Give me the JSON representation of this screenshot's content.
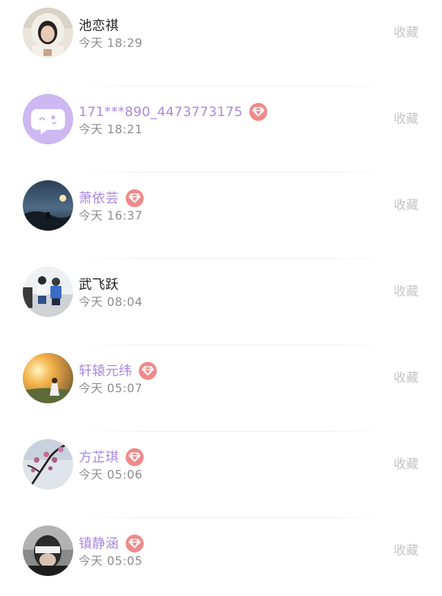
{
  "favorite_label": "收藏",
  "colors": {
    "vip_name": "#a989e0",
    "normal_name": "#222222",
    "time": "#8e8e8e",
    "favorite": "#c4c4c4",
    "vip_badge": "#ef8a8a"
  },
  "contacts": [
    {
      "name": "池恋祺",
      "time": "今天 18:29",
      "vip": false,
      "avatar": "photo-woman-hood"
    },
    {
      "name": "171***890_4473773175",
      "time": "今天 18:21",
      "vip": true,
      "avatar": "default-chat-bubble"
    },
    {
      "name": "萧依芸",
      "time": "今天 16:37",
      "vip": true,
      "avatar": "photo-night-sky"
    },
    {
      "name": "武飞跃",
      "time": "今天 08:04",
      "vip": false,
      "avatar": "photo-two-kids"
    },
    {
      "name": "轩辕元纬",
      "time": "今天 05:07",
      "vip": true,
      "avatar": "photo-sunset-girl"
    },
    {
      "name": "方芷琪",
      "time": "今天 05:06",
      "vip": true,
      "avatar": "photo-blossom-branch"
    },
    {
      "name": "镇静涵",
      "time": "今天 05:05",
      "vip": true,
      "avatar": "photo-masked-face"
    }
  ]
}
